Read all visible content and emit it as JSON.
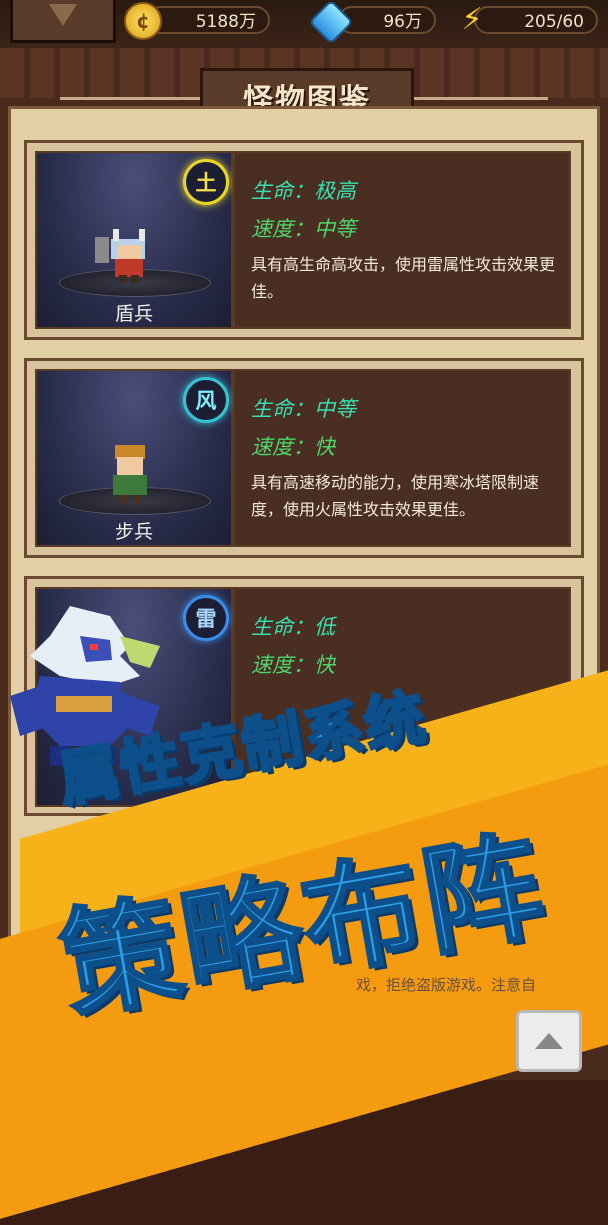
{
  "resources": {
    "gold": "5188万",
    "gems": "96万",
    "energy": "205/60"
  },
  "title": "怪物图鉴",
  "monsters": [
    {
      "name": "盾兵",
      "element": "土",
      "hp": "生命：极高",
      "speed": "速度：中等",
      "description": "具有高生命高攻击，使用雷属性攻击效果更佳。"
    },
    {
      "name": "步兵",
      "element": "风",
      "hp": "生命：中等",
      "speed": "速度：快",
      "description": "具有高速移动的能力，使用寒冰塔限制速度，使用火属性攻击效果更佳。"
    },
    {
      "element": "雷",
      "hp": "生命：低",
      "speed": "速度：快"
    }
  ],
  "promo": {
    "line1": "属性克制系统",
    "line2": "策略布阵"
  },
  "footer": {
    "notice": "戏，拒绝盗版游戏。注意自"
  },
  "colors": {
    "gold": "#f7b21a",
    "headline": "#2a9fe6",
    "hp": "#36e0b0",
    "speed": "#4bd66a"
  },
  "icons": {
    "gold": "coin-icon",
    "gems": "diamond-icon",
    "energy": "lightning-bolt-icon",
    "up": "arrow-up-icon"
  }
}
